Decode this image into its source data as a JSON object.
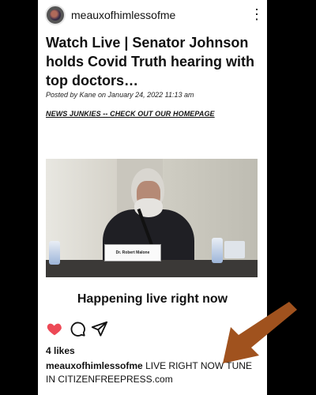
{
  "header": {
    "username": "meauxofhimlessofme",
    "more_icon": "⋮"
  },
  "post": {
    "title": "Watch Live | Senator Johnson holds Covid Truth hearing with top doctors…",
    "meta": "Posted by Kane on January 24, 2022 11:13 am",
    "homepage_link": "NEWS JUNKIES -- CHECK OUT OUR HOMEPAGE",
    "video_nameplate": "Dr. Robert Malone",
    "happening": "Happening live right now"
  },
  "actions": {
    "like_icon": "heart-icon",
    "comment_icon": "comment-icon",
    "share_icon": "send-icon",
    "like_color": "#ed4956"
  },
  "likes": "4 likes",
  "caption": {
    "username": "meauxofhimlessofme",
    "text": "LIVE RIGHT NOW TUNE IN CITIZENFREEPRESS.com"
  },
  "overlay": {
    "arrow_color": "#a0521e"
  }
}
